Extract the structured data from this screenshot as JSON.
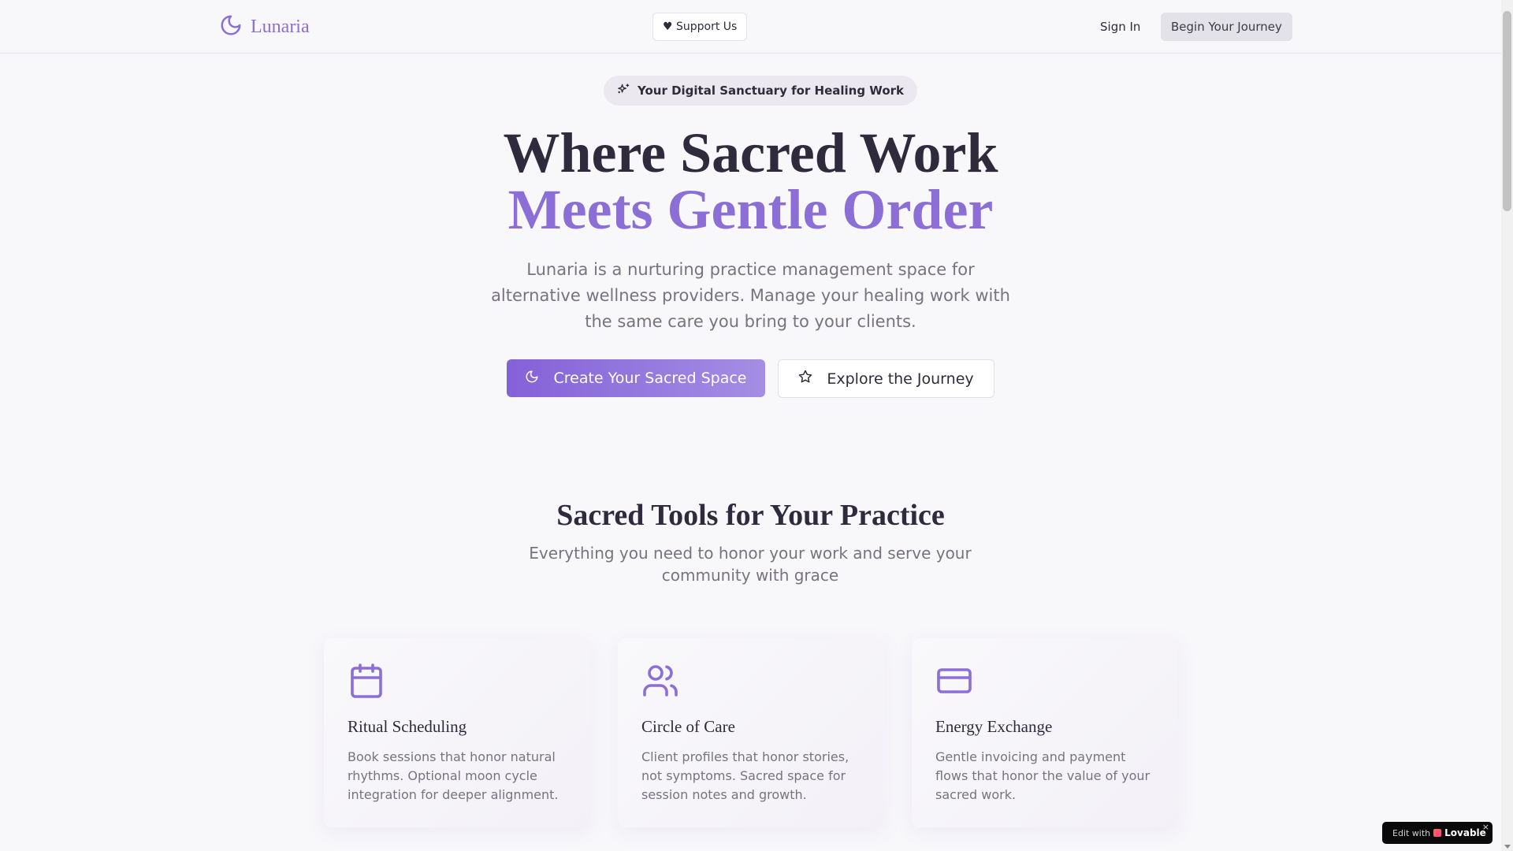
{
  "nav": {
    "brand": "Lunaria",
    "support_label": "♥ Support Us",
    "signin_label": "Sign In",
    "begin_label": "Begin Your Journey"
  },
  "hero": {
    "badge": "Your Digital Sanctuary for Healing Work",
    "title_line1": "Where Sacred Work",
    "title_line2": "Meets Gentle Order",
    "subtitle": "Lunaria is a nurturing practice management space for alternative wellness providers. Manage your healing work with the same care you bring to your clients.",
    "cta_primary": "Create Your Sacred Space",
    "cta_secondary": "Explore the Journey"
  },
  "features": {
    "title": "Sacred Tools for Your Practice",
    "subtitle": "Everything you need to honor your work and serve your community with grace",
    "cards": [
      {
        "icon": "calendar-icon",
        "title": "Ritual Scheduling",
        "description": "Book sessions that honor natural rhythms. Optional moon cycle integration for deeper alignment."
      },
      {
        "icon": "users-icon",
        "title": "Circle of Care",
        "description": "Client profiles that honor stories, not symptoms. Sacred space for session notes and growth."
      },
      {
        "icon": "credit-card-icon",
        "title": "Energy Exchange",
        "description": "Gentle invoicing and payment flows that honor the value of your sacred work."
      }
    ]
  },
  "lovable_badge": {
    "edit_text": "Edit with",
    "brand": "Lovable",
    "close": "×"
  },
  "colors": {
    "accent": "#8b6fd6",
    "background": "#f8f7fa",
    "text": "#2f2b3d",
    "muted": "#77737f"
  }
}
